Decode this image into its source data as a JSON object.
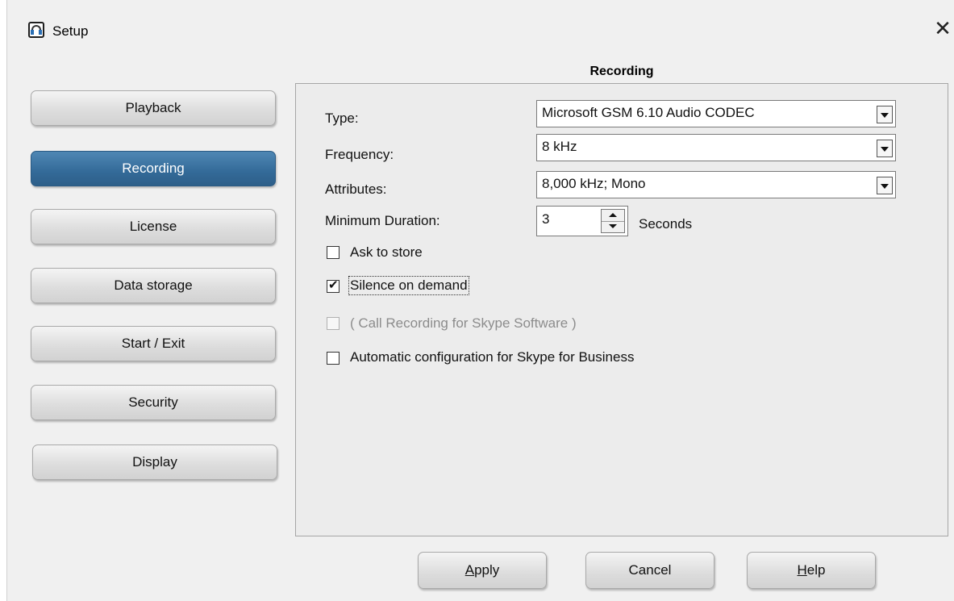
{
  "window": {
    "title": "Setup",
    "close_glyph": "✕",
    "icon": "headset-icon"
  },
  "sidebar": {
    "items": [
      {
        "label": "Playback",
        "active": false
      },
      {
        "label": "Recording",
        "active": true
      },
      {
        "label": "License",
        "active": false
      },
      {
        "label": "Data storage",
        "active": false
      },
      {
        "label": "Start / Exit",
        "active": false
      },
      {
        "label": "Security",
        "active": false
      },
      {
        "label": "Display",
        "active": false
      }
    ]
  },
  "section": {
    "title": "Recording"
  },
  "fields": {
    "type_label": "Type:",
    "type_value": "Microsoft GSM 6.10 Audio CODEC",
    "frequency_label": "Frequency:",
    "frequency_value": "8 kHz",
    "attributes_label": "Attributes:",
    "attributes_value": "8,000 kHz; Mono",
    "min_duration_label": "Minimum Duration:",
    "min_duration_value": "3",
    "min_duration_unit": "Seconds"
  },
  "checkboxes": [
    {
      "label": "Ask to store",
      "checked": false,
      "enabled": true
    },
    {
      "label": "Silence on demand",
      "checked": true,
      "enabled": true
    },
    {
      "label": "( Call Recording for Skype Software )",
      "checked": false,
      "enabled": false
    },
    {
      "label": "Automatic configuration for Skype for Business",
      "checked": false,
      "enabled": true
    }
  ],
  "buttons": {
    "apply_access": "A",
    "apply_rest": "pply",
    "cancel": "Cancel",
    "help_access": "H",
    "help_rest": "elp"
  },
  "colors": {
    "active_nav": "#336a98",
    "window_bg": "#f0f0f0"
  }
}
